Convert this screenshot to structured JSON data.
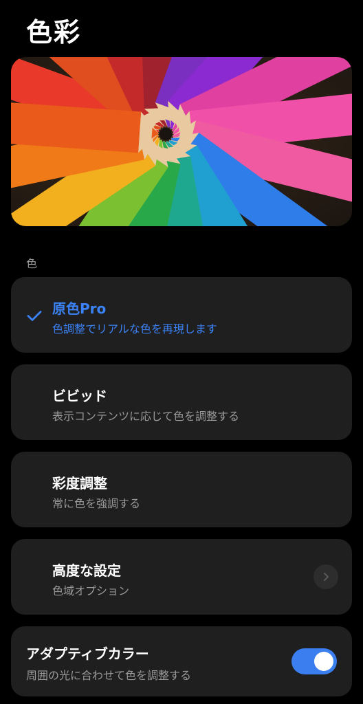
{
  "header": {
    "title": "色彩"
  },
  "preview": {
    "image": "colored-pencils-photo"
  },
  "section": {
    "label": "色"
  },
  "options": [
    {
      "title": "原色Pro",
      "subtitle": "色調整でリアルな色を再現します",
      "selected": true
    },
    {
      "title": "ビビッド",
      "subtitle": "表示コンテンツに応じて色を調整する",
      "selected": false
    },
    {
      "title": "彩度調整",
      "subtitle": "常に色を強調する",
      "selected": false
    }
  ],
  "advanced": {
    "title": "高度な設定",
    "subtitle": "色域オプション",
    "icon": "chevron-right-icon"
  },
  "adaptive": {
    "title": "アダプティブカラー",
    "subtitle": "周囲の光に合わせて色を調整する",
    "enabled": true
  },
  "colors": {
    "accent": "#3b82f6",
    "background": "#000000",
    "card": "#1f1f1f",
    "toggle_on": "#3b7ef0"
  }
}
